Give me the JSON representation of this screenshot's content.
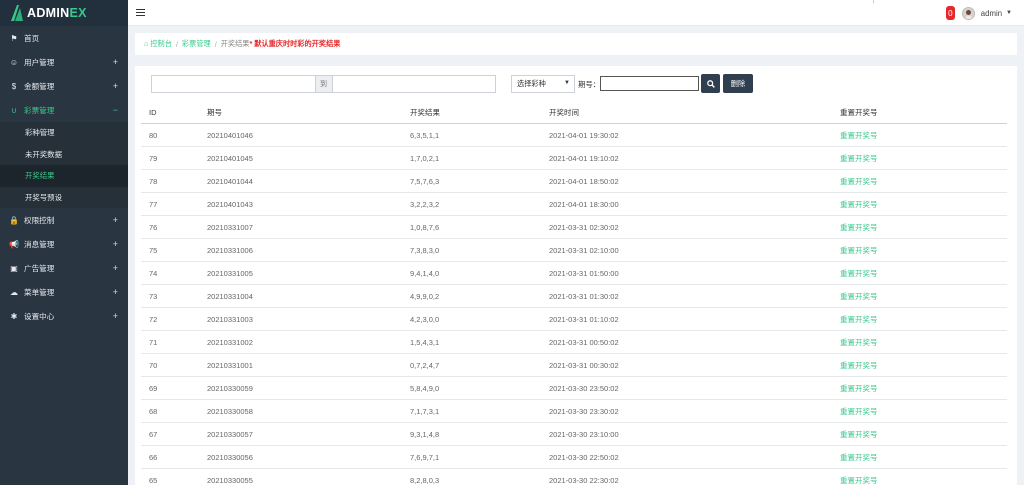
{
  "brand": {
    "name_main": "ADMIN",
    "name_accent": "EX"
  },
  "header": {
    "notification_count": "0",
    "user_name": "admin"
  },
  "sidebar": {
    "items": [
      {
        "label": "首页",
        "icon": "flag-icon",
        "glyph": "⚑",
        "expandable": false
      },
      {
        "label": "用户管理",
        "icon": "user-circle-icon",
        "glyph": "☺",
        "expandable": true,
        "toggle": "+"
      },
      {
        "label": "金额管理",
        "icon": "dollar-icon",
        "glyph": "$",
        "expandable": true,
        "toggle": "+"
      },
      {
        "label": "彩票管理",
        "icon": "magnet-icon",
        "glyph": "∪",
        "expandable": true,
        "toggle": "−",
        "active": true,
        "children": [
          {
            "label": "彩种管理"
          },
          {
            "label": "未开奖数据"
          },
          {
            "label": "开奖结果",
            "current": true
          },
          {
            "label": "开奖号预设"
          }
        ]
      },
      {
        "label": "权限控制",
        "icon": "lock-icon",
        "glyph": "🔒",
        "expandable": true,
        "toggle": "+"
      },
      {
        "label": "消息管理",
        "icon": "bullhorn-icon",
        "glyph": "📢",
        "expandable": true,
        "toggle": "+"
      },
      {
        "label": "广告管理",
        "icon": "image-icon",
        "glyph": "▣",
        "expandable": true,
        "toggle": "+"
      },
      {
        "label": "菜单管理",
        "icon": "cloud-icon",
        "glyph": "☁",
        "expandable": true,
        "toggle": "+"
      },
      {
        "label": "设置中心",
        "icon": "gear-icon",
        "glyph": "✱",
        "expandable": true,
        "toggle": "+"
      }
    ]
  },
  "breadcrumb": {
    "home": "控制台",
    "section": "彩票管理",
    "current": "开奖结果",
    "note": "* 默认重庆时时彩的开奖结果",
    "separator": "/"
  },
  "filter": {
    "range_to": "到",
    "select_value": "选择彩种",
    "issue_label": "期号：",
    "issue_value": "",
    "delete_label": "删除"
  },
  "table": {
    "headers": {
      "id": "ID",
      "issue": "期号",
      "result": "开奖结果",
      "time": "开奖时间",
      "action": "重置开奖号"
    },
    "rows": [
      {
        "id": "80",
        "issue": "20210401046",
        "result": "6,3,5,1,1",
        "time": "2021-04-01 19:30:02",
        "action": "重置开奖号"
      },
      {
        "id": "79",
        "issue": "20210401045",
        "result": "1,7,0,2,1",
        "time": "2021-04-01 19:10:02",
        "action": "重置开奖号"
      },
      {
        "id": "78",
        "issue": "20210401044",
        "result": "7,5,7,6,3",
        "time": "2021-04-01 18:50:02",
        "action": "重置开奖号"
      },
      {
        "id": "77",
        "issue": "20210401043",
        "result": "3,2,2,3,2",
        "time": "2021-04-01 18:30:00",
        "action": "重置开奖号"
      },
      {
        "id": "76",
        "issue": "20210331007",
        "result": "1,0,8,7,6",
        "time": "2021-03-31 02:30:02",
        "action": "重置开奖号"
      },
      {
        "id": "75",
        "issue": "20210331006",
        "result": "7,3,8,3,0",
        "time": "2021-03-31 02:10:00",
        "action": "重置开奖号"
      },
      {
        "id": "74",
        "issue": "20210331005",
        "result": "9,4,1,4,0",
        "time": "2021-03-31 01:50:00",
        "action": "重置开奖号"
      },
      {
        "id": "73",
        "issue": "20210331004",
        "result": "4,9,9,0,2",
        "time": "2021-03-31 01:30:02",
        "action": "重置开奖号"
      },
      {
        "id": "72",
        "issue": "20210331003",
        "result": "4,2,3,0,0",
        "time": "2021-03-31 01:10:02",
        "action": "重置开奖号"
      },
      {
        "id": "71",
        "issue": "20210331002",
        "result": "1,5,4,3,1",
        "time": "2021-03-31 00:50:02",
        "action": "重置开奖号"
      },
      {
        "id": "70",
        "issue": "20210331001",
        "result": "0,7,2,4,7",
        "time": "2021-03-31 00:30:02",
        "action": "重置开奖号"
      },
      {
        "id": "69",
        "issue": "20210330059",
        "result": "5,8,4,9,0",
        "time": "2021-03-30 23:50:02",
        "action": "重置开奖号"
      },
      {
        "id": "68",
        "issue": "20210330058",
        "result": "7,1,7,3,1",
        "time": "2021-03-30 23:30:02",
        "action": "重置开奖号"
      },
      {
        "id": "67",
        "issue": "20210330057",
        "result": "9,3,1,4,8",
        "time": "2021-03-30 23:10:00",
        "action": "重置开奖号"
      },
      {
        "id": "66",
        "issue": "20210330056",
        "result": "7,6,9,7,1",
        "time": "2021-03-30 22:50:02",
        "action": "重置开奖号"
      },
      {
        "id": "65",
        "issue": "20210330055",
        "result": "8,2,8,0,3",
        "time": "2021-03-30 22:30:02",
        "action": "重置开奖号"
      }
    ]
  },
  "colors": {
    "accent": "#38c98b",
    "sidebar_bg": "#2a3542",
    "badge": "#e5292b",
    "button_dark": "#2f3f50"
  }
}
